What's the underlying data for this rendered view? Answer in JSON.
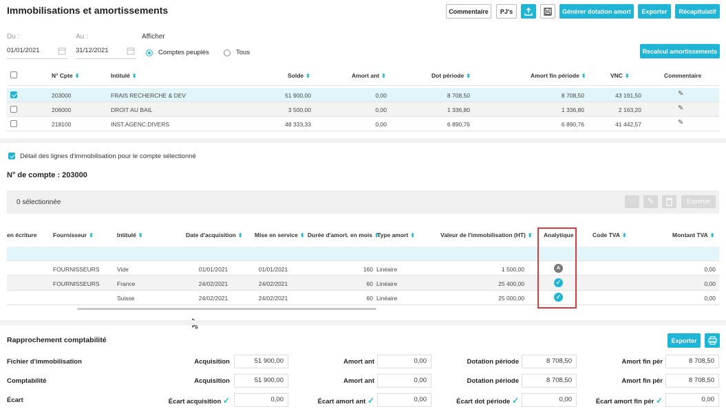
{
  "title": "Immobilisations et amortissements",
  "toolbar": {
    "commentaire": "Commentaire",
    "pjs": "PJ's",
    "generer": "Générer dotation amort",
    "exporter": "Exporter",
    "recap": "Récapitulatif"
  },
  "filters": {
    "du_label": "Du :",
    "au_label": "Au :",
    "du_value": "01/01/2021",
    "au_value": "31/12/2021",
    "afficher_label": "Afficher",
    "opt_peuples": "Comptes peuplés",
    "opt_tous": "Tous",
    "selected": "Comptes peuplés"
  },
  "recalcul_label": "Recalcul amortissements",
  "accounts_table": {
    "headers": [
      "N° Cpte",
      "Intitulé",
      "Solde",
      "Amort ant",
      "Dot période",
      "Amort fin période",
      "VNC",
      "Commentaire"
    ],
    "rows": [
      {
        "num": "203000",
        "intitule": "FRAIS RECHERCHE & DEV",
        "solde": "51 900,00",
        "amort_ant": "0,00",
        "dot": "8 708,50",
        "amort_fin": "8 708,50",
        "vnc": "43 191,50",
        "checked": true
      },
      {
        "num": "206000",
        "intitule": "DROIT AU BAIL",
        "solde": "3 500,00",
        "amort_ant": "0,00",
        "dot": "1 336,80",
        "amort_fin": "1 336,80",
        "vnc": "2 163,20",
        "checked": false
      },
      {
        "num": "218100",
        "intitule": "INST.AGENC.DIVERS",
        "solde": "48 333,33",
        "amort_ant": "0,00",
        "dot": "6 890,76",
        "amort_fin": "6 890,76",
        "vnc": "41 442,57",
        "checked": false
      }
    ]
  },
  "detail": {
    "checkbox_label": "Détail des lignes d'immobilisation pour le compte sélectionné",
    "compte_title": "N° de compte : 203000",
    "selection_count": "0 sélectionnée",
    "exporter": "Exporter",
    "more": "···"
  },
  "lines_table": {
    "headers": [
      "en écriture",
      "Fournisseur",
      "Intitulé",
      "Date d'acquisition",
      "Mise en service",
      "Durée d'amort. en mois",
      "Type amort",
      "Valeur de l'immobilisation (HT)",
      "Analytique",
      "Code TVA",
      "Montant TVA"
    ],
    "rows": [
      {
        "fournisseur": "FOURNISSEURS",
        "intitule": "Vide",
        "date_acq": "01/01/2021",
        "mise": "01/01/2021",
        "duree": "160",
        "type": "Linéaire",
        "valeur": "1 500,00",
        "analytique": "A",
        "montant_tva": "0,00"
      },
      {
        "fournisseur": "FOURNISSEURS",
        "intitule": "France",
        "date_acq": "24/02/2021",
        "mise": "24/02/2021",
        "duree": "60",
        "type": "Linéaire",
        "valeur": "25 400,00",
        "analytique": "check",
        "montant_tva": "0,00"
      },
      {
        "fournisseur": "",
        "intitule": "Suisse",
        "date_acq": "24/02/2021",
        "mise": "24/02/2021",
        "duree": "60",
        "type": "Linéaire",
        "valeur": "25 000,00",
        "analytique": "check",
        "montant_tva": "0,00"
      }
    ]
  },
  "rapprochement": {
    "title": "Rapprochement comptabilité",
    "exporter": "Exporter",
    "rows": [
      {
        "label": "Fichier d'immobilisation",
        "l1": "Acquisition",
        "v1": "51 900,00",
        "l2": "Amort ant",
        "v2": "0,00",
        "l3": "Dotation période",
        "v3": "8 708,50",
        "l4": "Amort fin pér",
        "v4": "8 708,50"
      },
      {
        "label": "Comptabilité",
        "l1": "Acquisition",
        "v1": "51 900,00",
        "l2": "Amort ant",
        "v2": "0,00",
        "l3": "Dotation période",
        "v3": "8 708,50",
        "l4": "Amort fin pér",
        "v4": "8 708,50"
      },
      {
        "label": "Écart",
        "l1": "Écart acquisition",
        "v1": "0,00",
        "l2": "Écart amort ant",
        "v2": "0,00",
        "l3": "Écart dot période",
        "v3": "0,00",
        "l4": "Écart amort fin pér",
        "v4": "0,00"
      }
    ]
  },
  "colors": {
    "accent": "#1fb5d6",
    "highlight": "#e2f5fa",
    "stripe": "#f3f3f3",
    "red_frame": "#d93a3a"
  }
}
